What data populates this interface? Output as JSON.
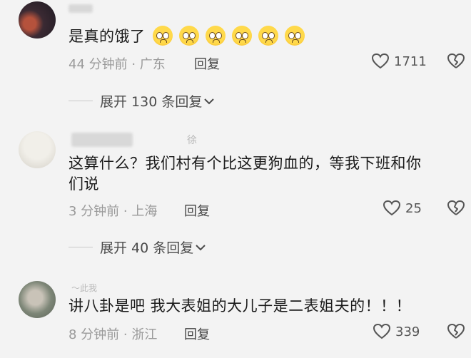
{
  "comments": [
    {
      "text": "是真的饿了",
      "meta": "44 分钟前 · 广东",
      "reply": "回复",
      "likes": "1711",
      "expand": "展开 130 条回复",
      "emoji_count": 6
    },
    {
      "text_line1": "这算什么？我们村有个比这更狗血的，等我下班和你",
      "text_line2": "们说",
      "name_hint": "徐",
      "meta": "3 分钟前 · 上海",
      "reply": "回复",
      "likes": "25",
      "expand": "展开 40 条回复"
    },
    {
      "text": "讲八卦是吧 我大表姐的大儿子是二表姐夫的！！！",
      "name_hint": "～此我",
      "meta": "8 分钟前 · 浙江",
      "reply": "回复",
      "likes": "339"
    }
  ],
  "icons": {
    "like": "heart-outline-icon",
    "dislike": "broken-heart-icon",
    "expand": "chevron-down-icon",
    "emoji": "pleading-face-emoji"
  },
  "colors": {
    "background": "#f3f3f3",
    "meta": "#9a9a9a"
  }
}
